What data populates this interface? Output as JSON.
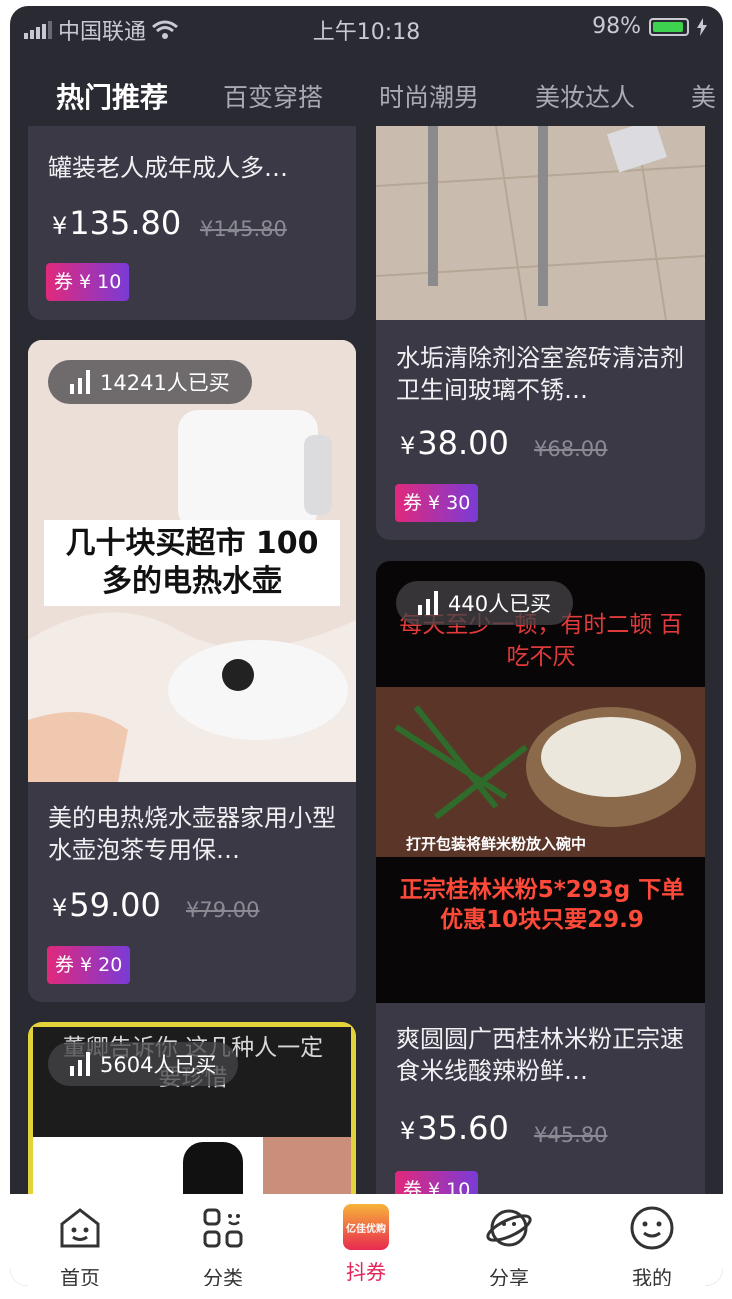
{
  "status": {
    "carrier": "中国联通",
    "time": "上午10:18",
    "battery": "98%"
  },
  "tabs": [
    "热门推荐",
    "百变穿搭",
    "时尚潮男",
    "美妆达人",
    "美"
  ],
  "products": [
    {
      "title": "罐装老人成年成人多…",
      "price": "135.80",
      "old": "¥145.80",
      "coupon": "券 ¥ 10"
    },
    {
      "title": "水垢清除剂浴室瓷砖清洁剂卫生间玻璃不锈…",
      "price": "38.00",
      "old": "¥68.00",
      "coupon": "券 ¥ 30"
    },
    {
      "buyers": "14241人已买",
      "img_text": "几十块买超市 100多的电热水壶",
      "title": "美的电热烧水壶器家用小型水壶泡茶专用保…",
      "price": "59.00",
      "old": "¥79.00",
      "coupon": "券 ¥ 20"
    },
    {
      "buyers": "440人已买",
      "img_top": "每天至少一顿，有时二顿 百吃不厌",
      "img_mid": "打开包装将鲜米粉放入碗中",
      "img_bottom": "正宗桂林米粉5*293g 下单优惠10块只要29.9",
      "title": "爽圆圆广西桂林米粉正宗速食米线酸辣粉鲜…",
      "price": "35.60",
      "old": "¥45.80",
      "coupon": "券 ¥ 10"
    },
    {
      "buyers": "5604人已买",
      "img_text": "董卿告诉你 这几种人一定要珍惜"
    }
  ],
  "yen": "¥",
  "nav": [
    {
      "label": "首页",
      "icon": "home-icon"
    },
    {
      "label": "分类",
      "icon": "category-icon"
    },
    {
      "label": "抖券",
      "icon": "coupon-logo-icon",
      "active": true,
      "logo_text": "亿佳优购"
    },
    {
      "label": "分享",
      "icon": "planet-icon"
    },
    {
      "label": "我的",
      "icon": "smiley-icon"
    }
  ],
  "colors": {
    "background": "#2a2a33",
    "card": "#3a3945",
    "accent": "#e3245a"
  }
}
